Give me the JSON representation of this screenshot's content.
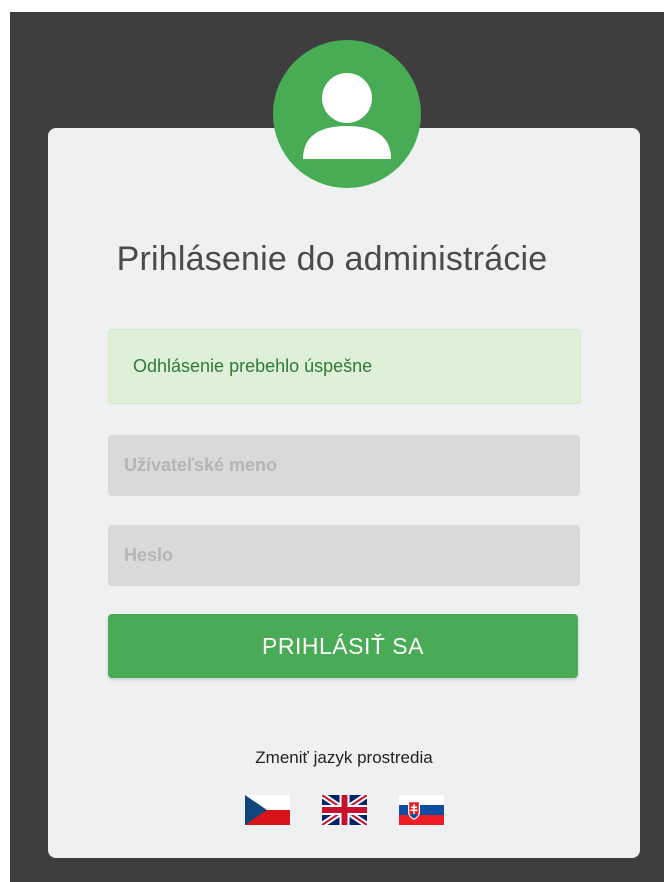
{
  "login": {
    "title": "Prihlásenie do administrácie",
    "alert_message": "Odhlásenie prebehlo úspešne",
    "username_placeholder": "Užívateľské meno",
    "password_placeholder": "Heslo",
    "submit_label": "PRIHLÁSIŤ SA"
  },
  "language": {
    "label": "Zmeniť jazyk prostredia",
    "flags": [
      "cz-flag-icon",
      "gb-flag-icon",
      "sk-flag-icon"
    ]
  },
  "colors": {
    "accent": "#48ac55",
    "backdrop": "#3e3e3e",
    "card": "#eff0f2",
    "alert_bg": "#dff0d8",
    "alert_text": "#2f7a3a"
  }
}
